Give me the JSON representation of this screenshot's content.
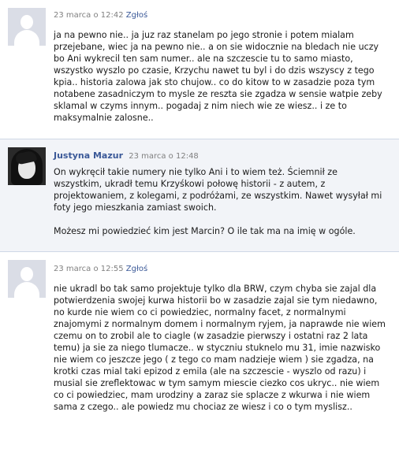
{
  "comments": [
    {
      "author": "",
      "date": "23 marca o 12:42",
      "report_label": "Zgłoś",
      "paragraphs": [
        "ja na pewno nie.. ja juz raz stanelam po jego stronie i potem mialam przejebane, wiec ja na pewno nie.. a on sie widocznie na bledach nie uczy bo Ani wykrecil ten sam numer.. ale na szczescie tu to samo miasto, wszystko wyszlo po czasie, Krzychu nawet tu byl i do dzis wszyscy z tego kpia.. historia zalowa jak sto chujow.. co do kitow to w zasadzie poza tym notabene zasadniczym to mysle ze reszta sie zgadza w sensie watpie zeby sklamal w czyms innym.. pogadaj z nim niech wie ze wiesz.. i ze to maksymalnie zalosne.."
      ]
    },
    {
      "author": "Justyna Mazur",
      "date": "23 marca o 12:48",
      "report_label": "",
      "paragraphs": [
        "On wykręcił takie numery nie tylko Ani i to wiem też. Ściemnił ze wszystkim, ukradł temu Krzyśkowi połowę historii - z autem, z projektowaniem, z kolegami, z podróżami, ze wszystkim. Nawet wysyłał mi foty jego mieszkania zamiast swoich.",
        "Możesz mi powiedzieć kim jest Marcin? O ile tak ma na imię w ogóle."
      ]
    },
    {
      "author": "",
      "date": "23 marca o 12:55",
      "report_label": "Zgłoś",
      "paragraphs": [
        "nie ukradl bo tak samo projektuje tylko dla BRW, czym chyba sie zajal dla potwierdzenia swojej kurwa historii bo w zasadzie zajal sie tym niedawno, no kurde nie wiem co ci powiedziec, normalny facet, z normalnymi znajomymi z normalnym domem i normalnym ryjem, ja naprawde nie wiem czemu on to zrobil ale to ciagle (w zasadzie pierwszy i ostatni raz 2 lata temu) ja sie za niego tlumacze.. w styczniu stuknelo mu 31, imie nazwisko nie wiem co jeszcze jego ( z tego co mam nadzieje wiem ) sie zgadza, na krotki czas mial taki epizod z emila (ale na szczescie - wyszlo od razu) i musial sie zreflektowac w tym samym miescie ciezko cos ukryc.. nie wiem co ci powiedziec, mam urodziny a zaraz sie splacze z wkurwa i nie wiem sama z czego.. ale powiedz mu chociaz ze wiesz i co o tym myslisz.."
      ]
    }
  ]
}
